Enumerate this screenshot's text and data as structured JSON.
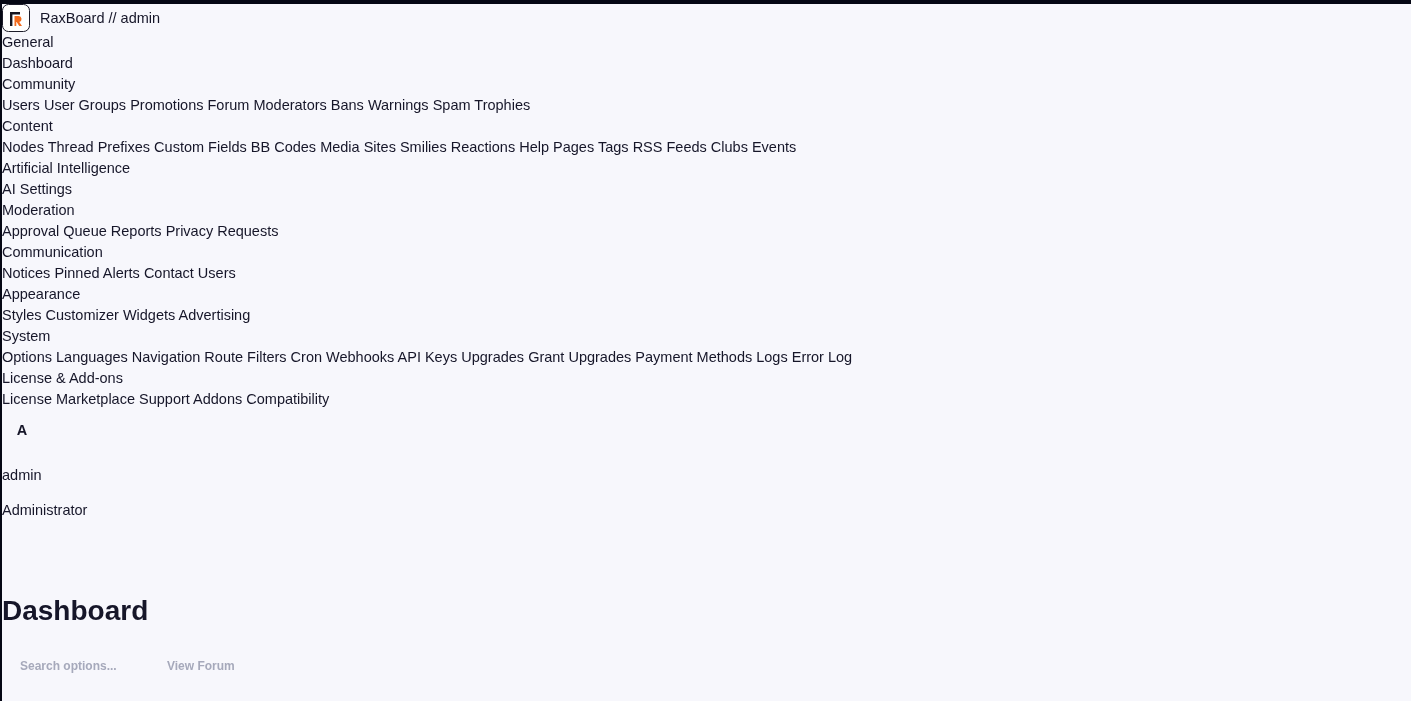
{
  "header": {
    "title": "RaxBoard // admin"
  },
  "nav": [
    {
      "heading": "General",
      "items": [
        "Dashboard"
      ]
    },
    {
      "heading": "Community",
      "items": [
        "Users",
        "User Groups",
        "Promotions",
        "Forum Moderators",
        "Bans",
        "Warnings",
        "Spam",
        "Trophies"
      ]
    },
    {
      "heading": "Content",
      "items": [
        "Nodes",
        "Thread Prefixes",
        "Custom Fields",
        "BB Codes",
        "Media Sites",
        "Smilies",
        "Reactions",
        "Help Pages",
        "Tags",
        "RSS Feeds",
        "Clubs",
        "Events"
      ]
    },
    {
      "heading": "Artificial Intelligence",
      "items": [
        "AI Settings"
      ]
    },
    {
      "heading": "Moderation",
      "items": [
        "Approval Queue",
        "Reports",
        "Privacy Requests"
      ]
    },
    {
      "heading": "Communication",
      "items": [
        "Notices",
        "Pinned Alerts",
        "Contact Users"
      ]
    },
    {
      "heading": "Appearance",
      "items": [
        "Styles",
        "Customizer",
        "Widgets",
        "Advertising"
      ]
    },
    {
      "heading": "System",
      "items": [
        "Options",
        "Languages",
        "Navigation",
        "Route Filters",
        "Cron",
        "Webhooks",
        "API Keys",
        "Upgrades",
        "Grant Upgrades",
        "Payment Methods",
        "Logs",
        "Error Log"
      ]
    },
    {
      "heading": "License & Add-ons",
      "items": [
        "License",
        "Marketplace",
        "Support",
        "Addons",
        "Compatibility"
      ]
    }
  ],
  "user": {
    "avatar_initial": "A",
    "name": "admin",
    "role": "Administrator"
  },
  "page": {
    "title": "Dashboard"
  },
  "toolbar": {
    "search": {
      "placeholder": "Search options..."
    },
    "links": [
      "View Forum"
    ]
  }
}
